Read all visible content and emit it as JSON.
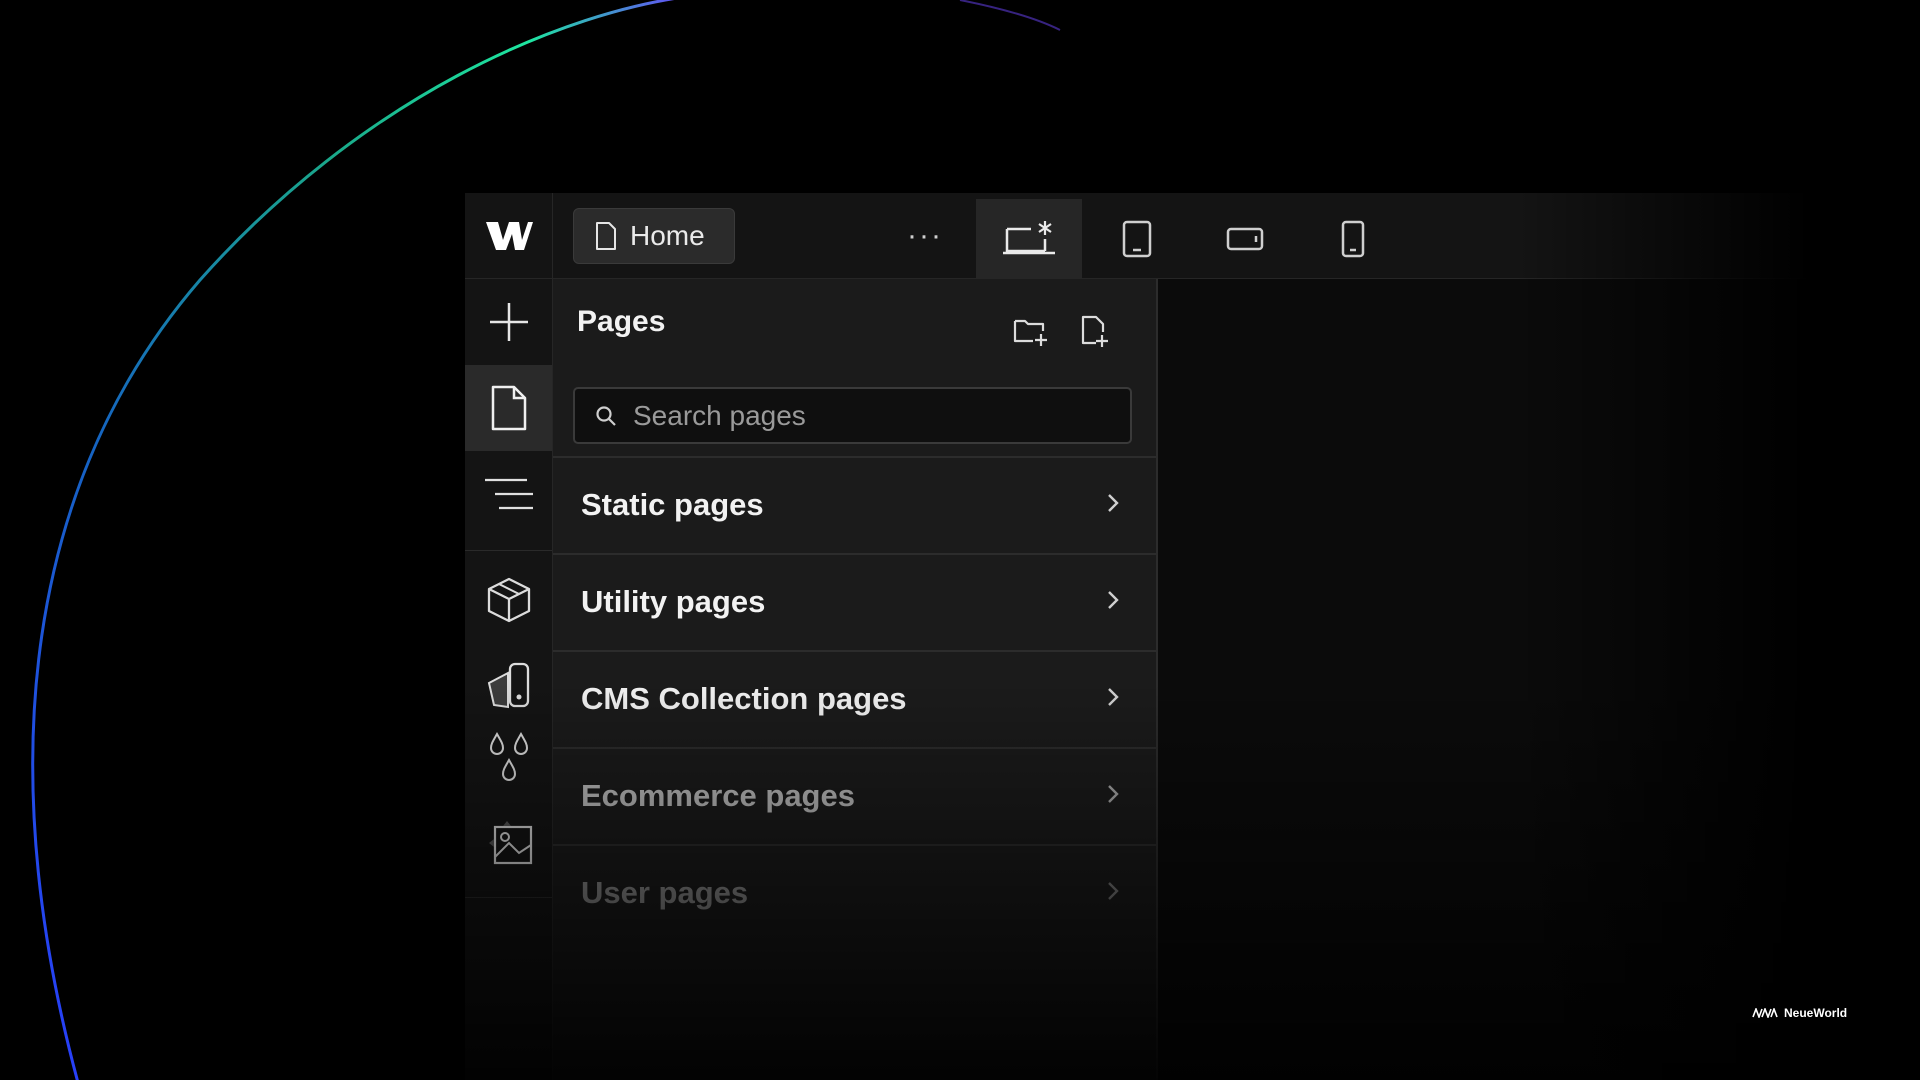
{
  "toolbar": {
    "page_name": "Home",
    "more_label": "···"
  },
  "panel": {
    "title": "Pages",
    "search_placeholder": "Search pages"
  },
  "sections": [
    {
      "label": "Static pages",
      "color": "#f2f2f2"
    },
    {
      "label": "Utility pages",
      "color": "#f2f2f2"
    },
    {
      "label": "CMS Collection pages",
      "color": "#f2f2f2"
    },
    {
      "label": "Ecommerce pages",
      "color": "#bdbdbd"
    },
    {
      "label": "User pages",
      "color": "#8a8a8a"
    }
  ],
  "watermark": {
    "brand": "NeueWorld"
  },
  "colors": {
    "accent_green": "#1ee6a0",
    "accent_purple": "#8a4dff",
    "accent_blue": "#3b6cff"
  }
}
